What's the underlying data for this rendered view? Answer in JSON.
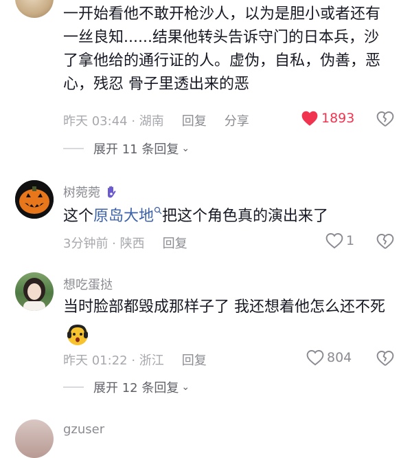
{
  "comments": [
    {
      "text_lines": [
        "一开始看他不敢开枪沙人，以为是胆小或者还有",
        "一丝良知......结果他转头告诉守门的日本兵，沙",
        "了拿他给的通行证的人。虚伪，自私，伪善，恶",
        "心，残忍 骨子里透出来的恶"
      ],
      "time": "昨天 03:44 · 湖南",
      "reply_label": "回复",
      "share_label": "分享",
      "likes": "1893",
      "liked": true,
      "expand_label": "展开 11 条回复"
    },
    {
      "username": "树菀菀",
      "text_before": "这个",
      "link_text": "原岛大地",
      "text_after": "把这个角色真的演出来了",
      "time": "3分钟前 · 陕西",
      "reply_label": "回复",
      "likes": "1"
    },
    {
      "username": "想吃蛋挞",
      "text": "当时脸部都毁成那样子了 我还想着他怎么还不死",
      "time": "昨天 01:22 · 浙江",
      "reply_label": "回复",
      "likes": "804",
      "expand_label": "展开 12 条回复"
    },
    {
      "username": "gzuser"
    }
  ],
  "colors": {
    "like_active": "#f0344f",
    "link": "#3c62a8",
    "muted": "#a7a8ad"
  }
}
